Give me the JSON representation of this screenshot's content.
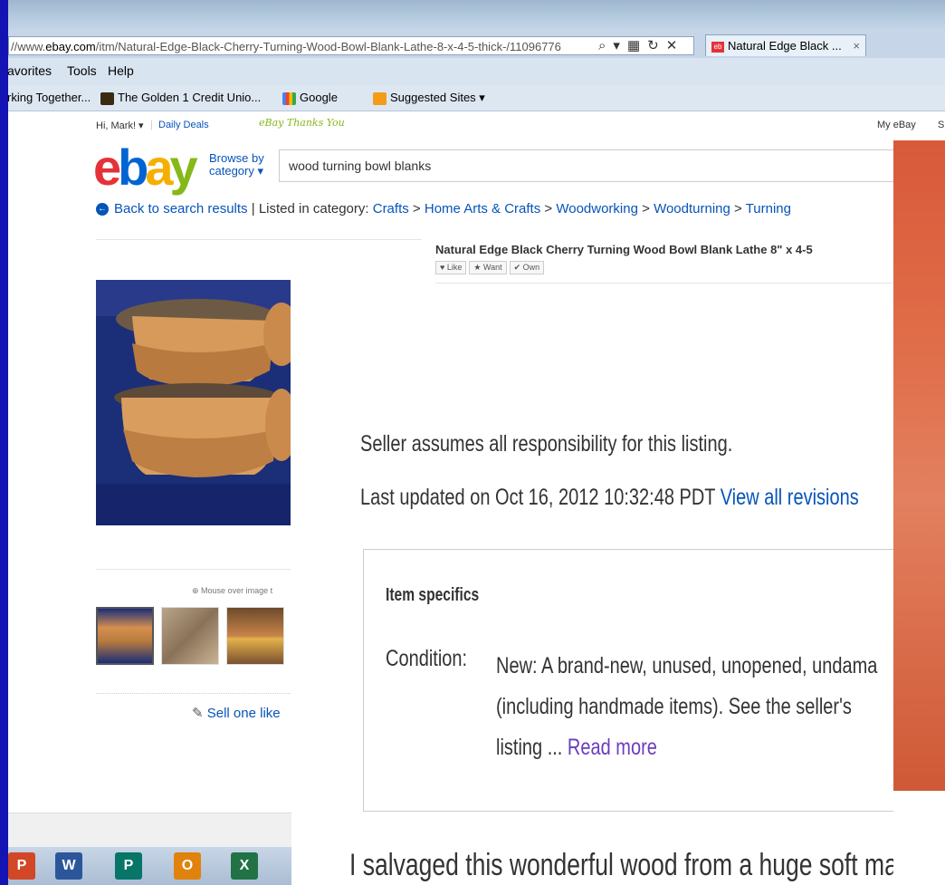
{
  "browser": {
    "url_prefix": "//www.",
    "url_domain": "ebay.com",
    "url_path": "/itm/Natural-Edge-Black-Cherry-Turning-Wood-Bowl-Blank-Lathe-8-x-4-5-thick-/11096776",
    "tab_title": "Natural Edge Black ...",
    "tab_close": "×",
    "menu": [
      "avorites",
      "Tools",
      "Help"
    ],
    "favorites": [
      "rking Together...",
      "The Golden 1 Credit Unio...",
      "Google",
      "Suggested Sites ▾"
    ]
  },
  "ebay_header": {
    "greeting": "Hi, Mark! ▾",
    "daily_deals": "Daily Deals",
    "thank_you": "eBay Thanks You",
    "my_ebay": "My eBay",
    "cut_letter": "S",
    "logo": {
      "e": "e",
      "b": "b",
      "a": "a",
      "y": "y"
    },
    "browse_line1": "Browse by",
    "browse_line2": "category ▾",
    "search_value": "wood turning bowl blanks"
  },
  "breadcrumb": {
    "back": "Back to search results",
    "separator": "|",
    "listed_in": "Listed in category:",
    "crumbs": [
      "Crafts",
      "Home Arts & Crafts",
      "Woodworking",
      "Woodturning",
      "Turning"
    ],
    "arrow": ">"
  },
  "item": {
    "title": "Natural Edge Black Cherry Turning Wood Bowl Blank Lathe 8\" x 4-5",
    "like": "♥ Like",
    "want": "★ Want",
    "own": "✔ Own",
    "mouse_hint": "Mouse over image t",
    "sell_one": "Sell one like"
  },
  "zoom": {
    "responsibility": "Seller assumes all responsibility for this listing.",
    "updated_label": "Last updated on  Oct 16, 2012 10:32:48 PDT ",
    "view_revisions": "View all revisions",
    "specs_title": "Item specifics",
    "condition_label": "Condition:",
    "condition_line1": "New: A brand-new, unused, unopened, undama",
    "condition_line2": "(including handmade items). See the seller's",
    "condition_line3": "listing ... ",
    "read_more": "Read more",
    "salvaged": "I salvaged this wonderful wood from a huge soft maple"
  },
  "taskbar": [
    "P",
    "W",
    "P",
    "O",
    "X"
  ],
  "colors": {
    "ebay_red": "#e53238",
    "ebay_blue": "#0654ba",
    "ebay_yellow": "#f5af02",
    "ebay_green": "#86b817",
    "left_bar": "#1414b4",
    "wood_orange": "#d85a3a"
  }
}
